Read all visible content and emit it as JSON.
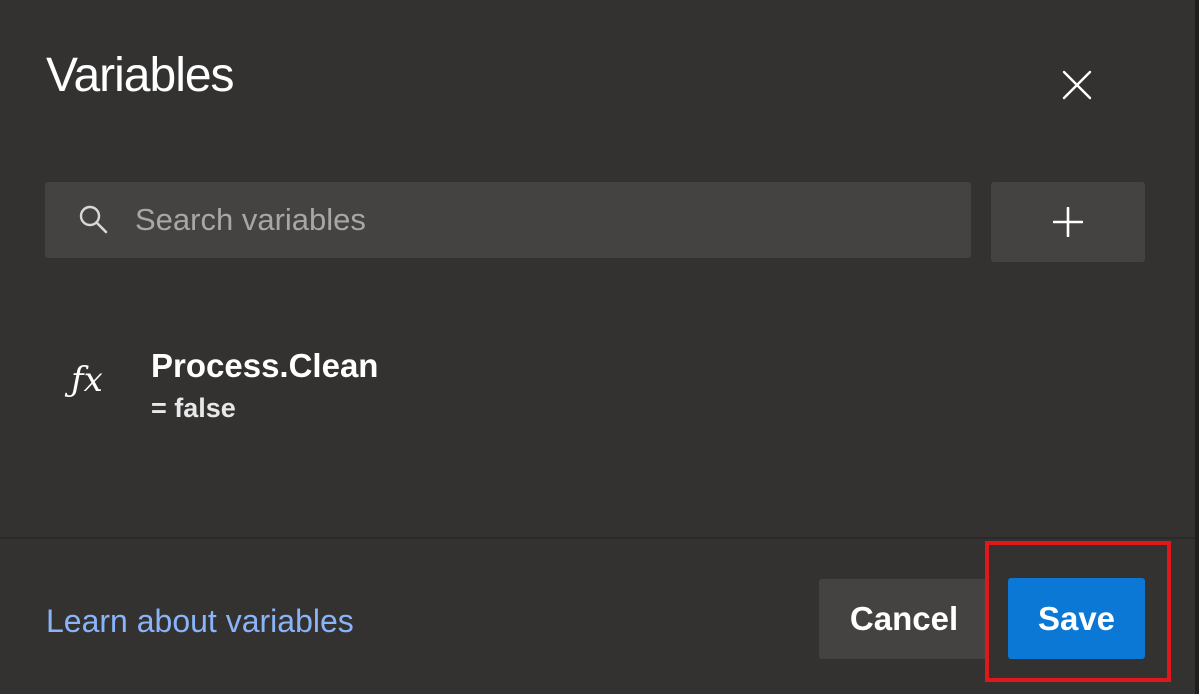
{
  "dialog": {
    "title": "Variables"
  },
  "search": {
    "placeholder": "Search variables",
    "value": ""
  },
  "toolbar": {
    "add_icon": "plus-icon",
    "close_icon": "close-icon"
  },
  "variables": [
    {
      "name": "Process.Clean",
      "value": "= false",
      "icon": "fx-icon",
      "icon_glyph": "ƒx"
    }
  ],
  "footer": {
    "learn_link": "Learn about variables",
    "cancel_label": "Cancel",
    "save_label": "Save"
  },
  "colors": {
    "background": "#333231",
    "control_background": "#444342",
    "primary_button": "#0a78d4",
    "link": "#8ab4f8",
    "highlight": "#e0171b"
  }
}
